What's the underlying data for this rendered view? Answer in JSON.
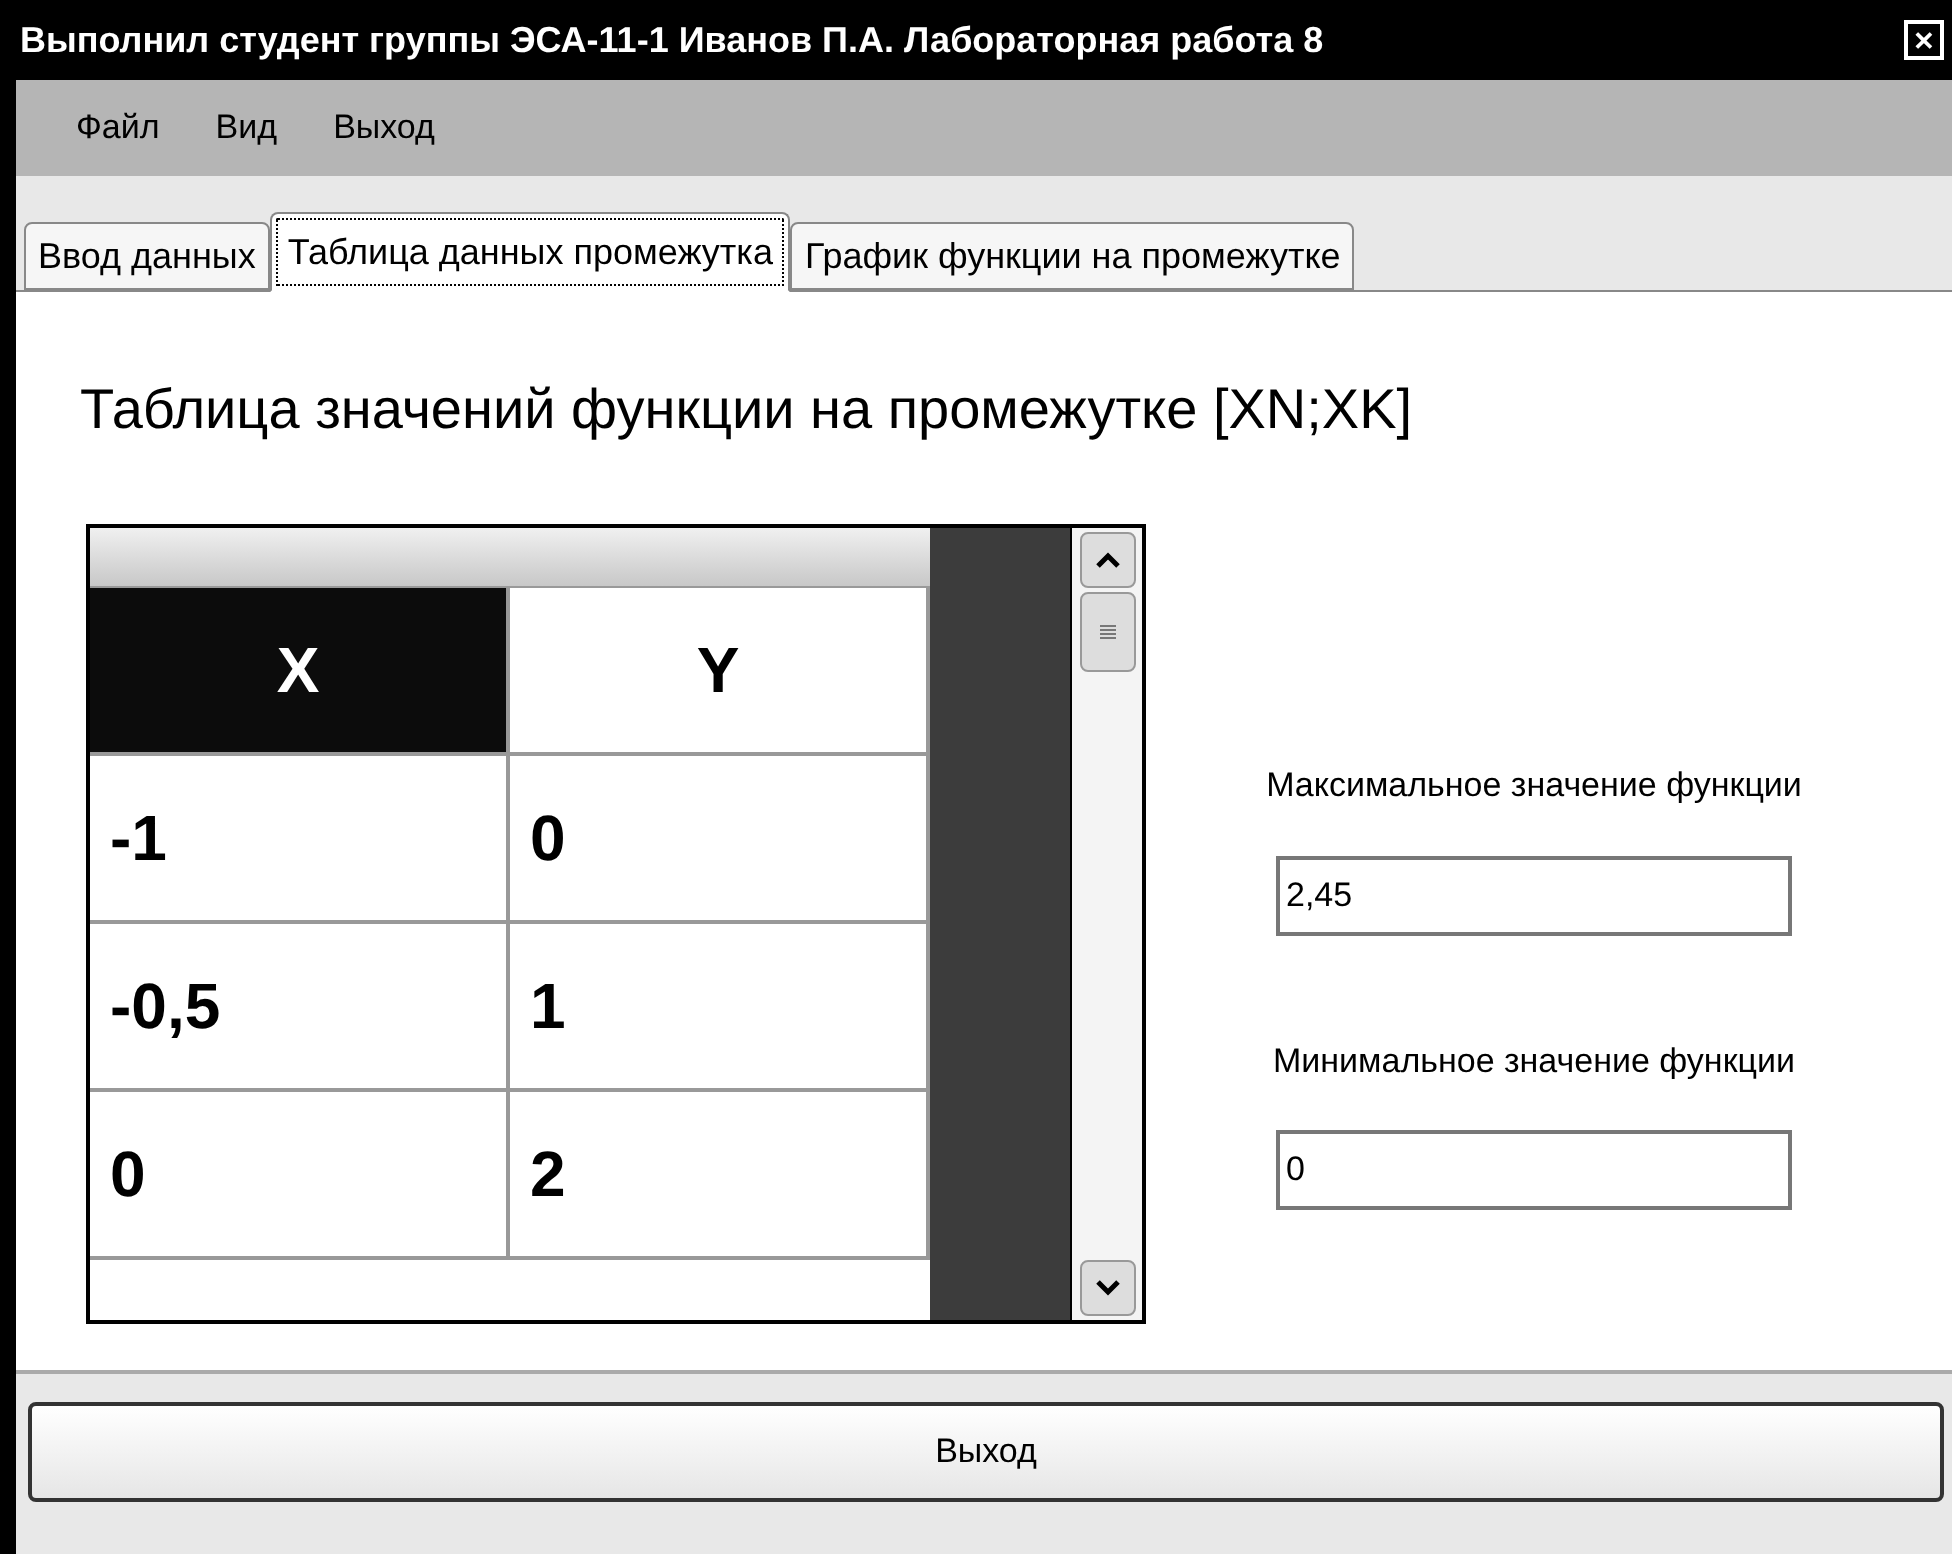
{
  "window": {
    "title": "Выполнил студент группы ЭСА-11-1 Иванов П.А. Лабораторная работа 8",
    "close": "✕"
  },
  "menu": [
    "Файл",
    "Вид",
    "Выход"
  ],
  "tabs": [
    {
      "label": "Ввод данных",
      "selected": false
    },
    {
      "label": "Таблица данных промежутка",
      "selected": true
    },
    {
      "label": "График функции на промежутке",
      "selected": false
    }
  ],
  "heading": "Таблица значений функции на промежутке [XN;XK]",
  "table": {
    "columns": [
      {
        "label": "X",
        "selected": true
      },
      {
        "label": "Y",
        "selected": false
      }
    ],
    "rows": [
      [
        "-1",
        "0"
      ],
      [
        "-0,5",
        "1"
      ],
      [
        "0",
        "2"
      ]
    ]
  },
  "max": {
    "label": "Максимальное значение функции",
    "value": "2,45"
  },
  "min": {
    "label": "Минимальное значение функции",
    "value": "0"
  },
  "exit_button": "Выход"
}
